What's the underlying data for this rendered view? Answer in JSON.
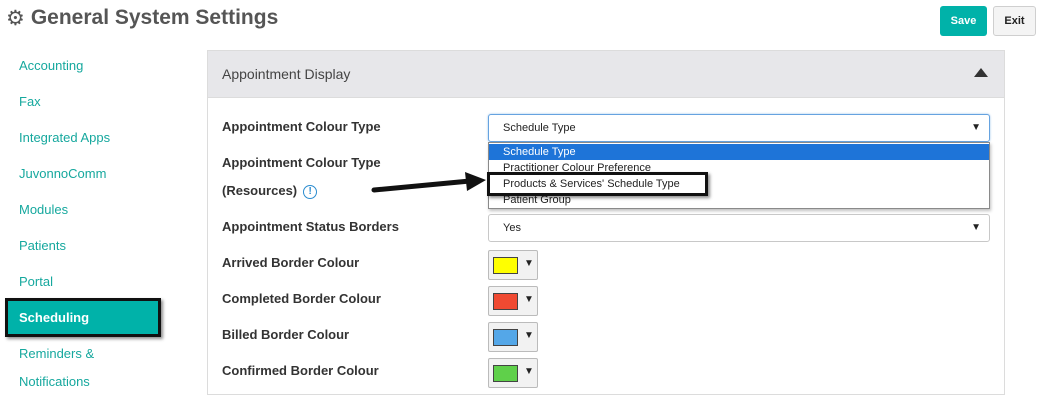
{
  "header": {
    "title": "General System Settings",
    "icon": "gear-icon",
    "save_label": "Save",
    "exit_label": "Exit"
  },
  "sidebar": {
    "items": [
      {
        "label": "Accounting"
      },
      {
        "label": "Fax"
      },
      {
        "label": "Integrated Apps"
      },
      {
        "label": "JuvonnoComm"
      },
      {
        "label": "Modules"
      },
      {
        "label": "Patients"
      },
      {
        "label": "Portal"
      },
      {
        "label": "Scheduling",
        "active": true
      },
      {
        "label": "Reminders &"
      },
      {
        "label": "Notifications"
      }
    ]
  },
  "panel": {
    "title": "Appointment Display",
    "rows": {
      "colour_type": {
        "label": "Appointment Colour Type",
        "value": "Schedule Type"
      },
      "colour_type_resources": {
        "label_line1": "Appointment Colour Type",
        "label_line2": "(Resources)"
      },
      "status_borders": {
        "label": "Appointment Status Borders",
        "value": "Yes"
      },
      "arrived": {
        "label": "Arrived Border Colour",
        "color": "#ffff00"
      },
      "completed": {
        "label": "Completed Border Colour",
        "color": "#f04a32"
      },
      "billed": {
        "label": "Billed Border Colour",
        "color": "#54a7e8"
      },
      "confirmed": {
        "label": "Confirmed Border Colour",
        "color": "#5fd04a"
      }
    },
    "dropdown_options": [
      {
        "label": "Schedule Type",
        "selected": true
      },
      {
        "label": "Practitioner Colour Preference"
      },
      {
        "label": "Products & Services' Schedule Type",
        "highlighted": true
      },
      {
        "label": "Patient Group"
      }
    ]
  },
  "colors": {
    "accent": "#00b2a9",
    "link": "#16a89e",
    "dropdown_selected": "#1e74d8",
    "info": "#2b8ccf"
  }
}
